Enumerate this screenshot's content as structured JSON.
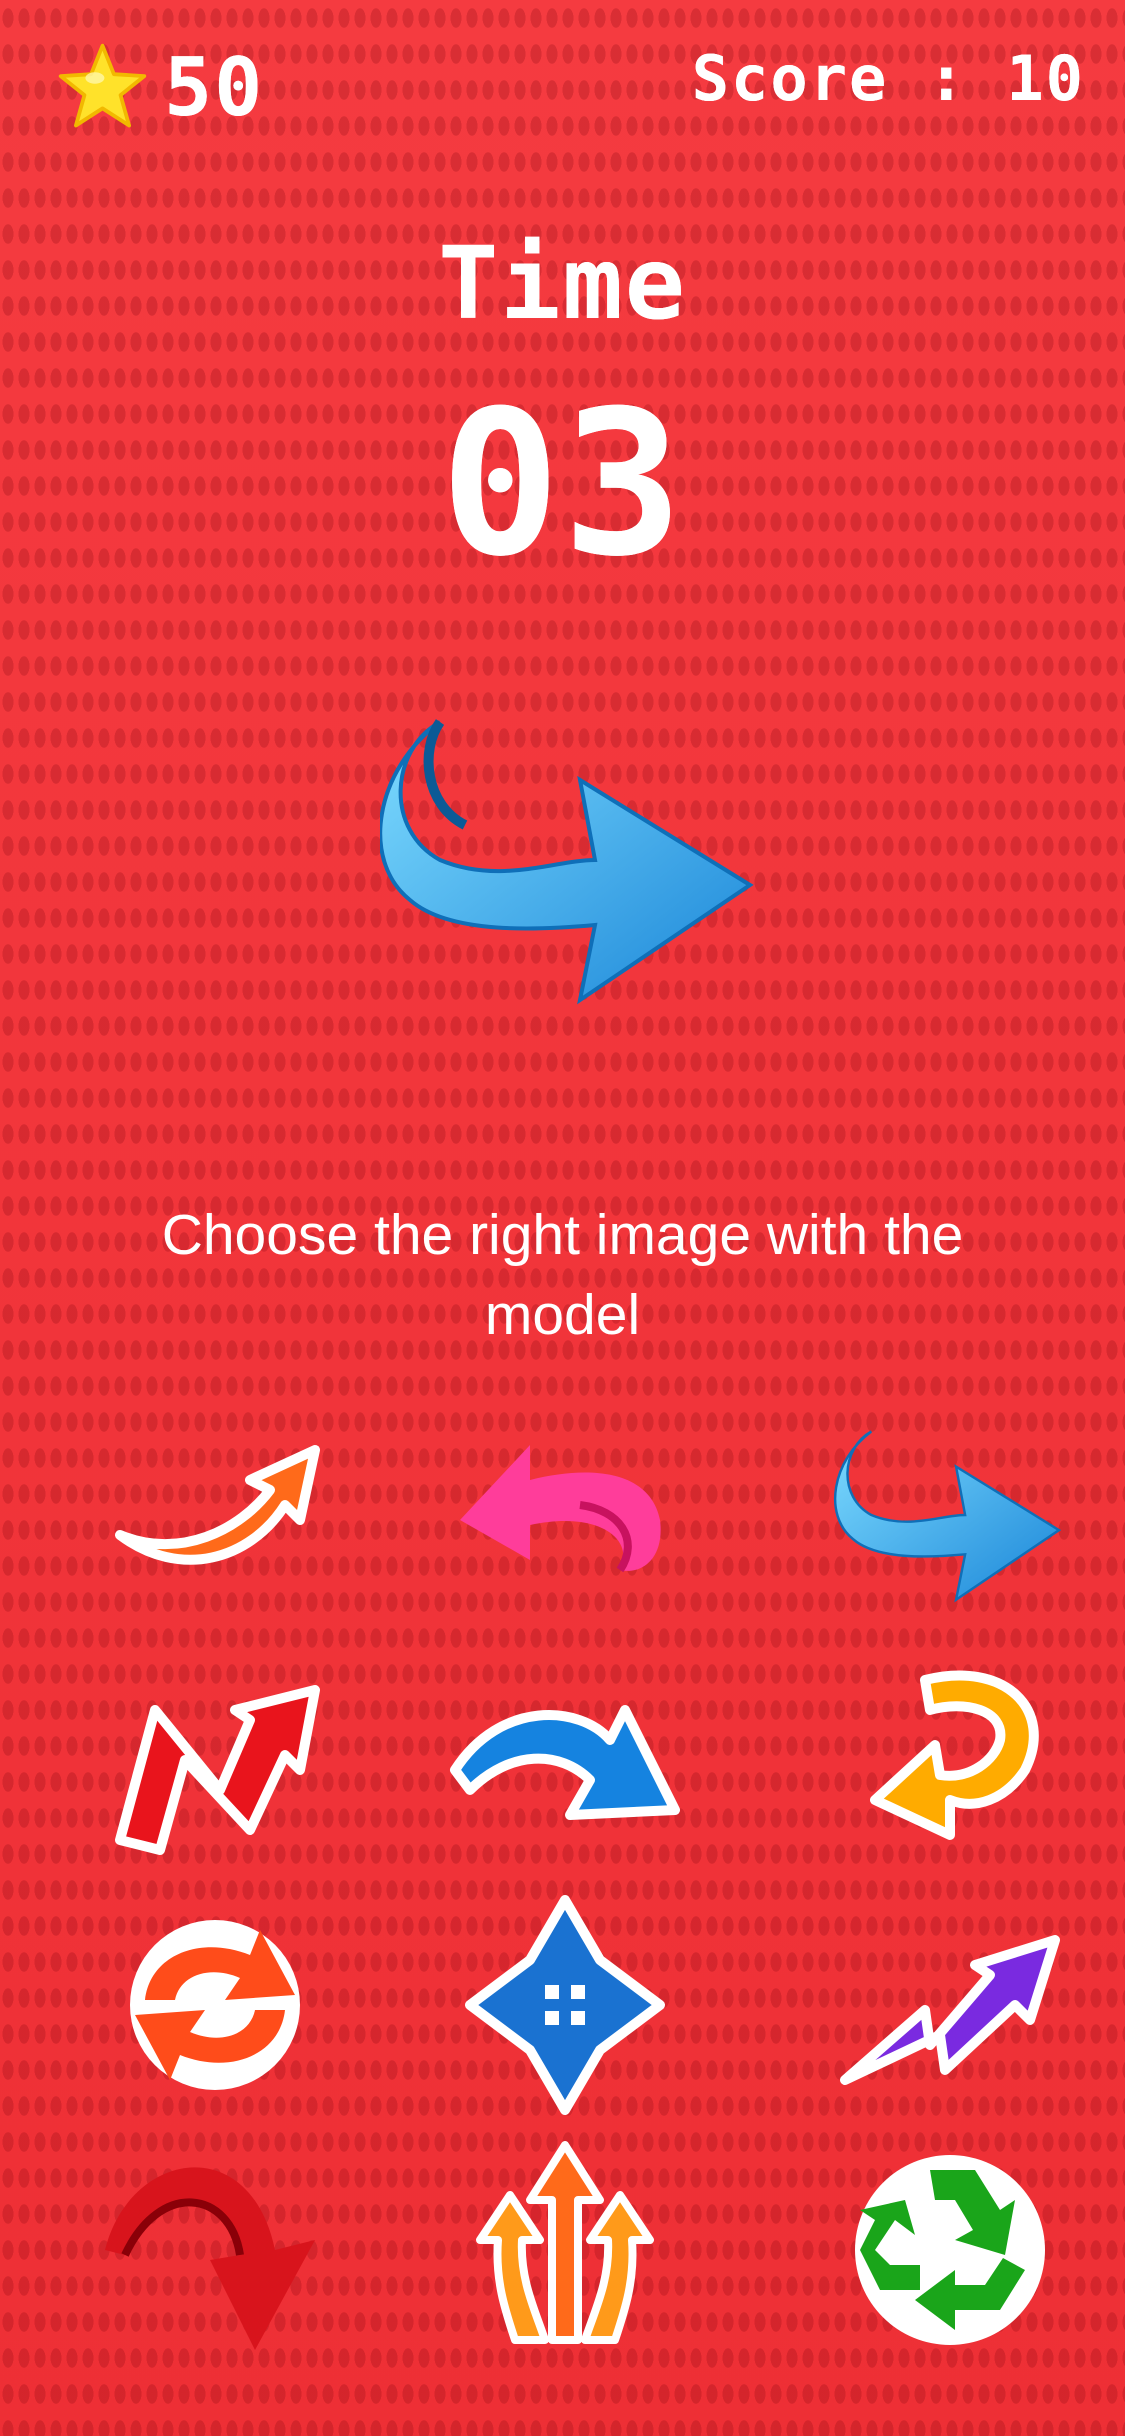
{
  "hud": {
    "coins": "50",
    "score": "Score : 10"
  },
  "timer": {
    "label": "Time",
    "value": "03"
  },
  "instruction": "Choose the right image with the model",
  "options": [
    {
      "name": "option-orange-swoosh-arrow"
    },
    {
      "name": "option-pink-curved-arrow"
    },
    {
      "name": "option-blue-3d-arrow"
    },
    {
      "name": "option-red-zigzag-arrow"
    },
    {
      "name": "option-blue-curved-arrow"
    },
    {
      "name": "option-yellow-uturn-arrow"
    },
    {
      "name": "option-refresh-arrows"
    },
    {
      "name": "option-four-way-arrows"
    },
    {
      "name": "option-purple-zigzag-arrow"
    },
    {
      "name": "option-red-3d-curved-arrow"
    },
    {
      "name": "option-triple-up-arrows"
    },
    {
      "name": "option-recycle-arrows"
    }
  ],
  "colors": {
    "background": "#f2353b",
    "text": "#ffffff",
    "star": "#ffe22a"
  }
}
